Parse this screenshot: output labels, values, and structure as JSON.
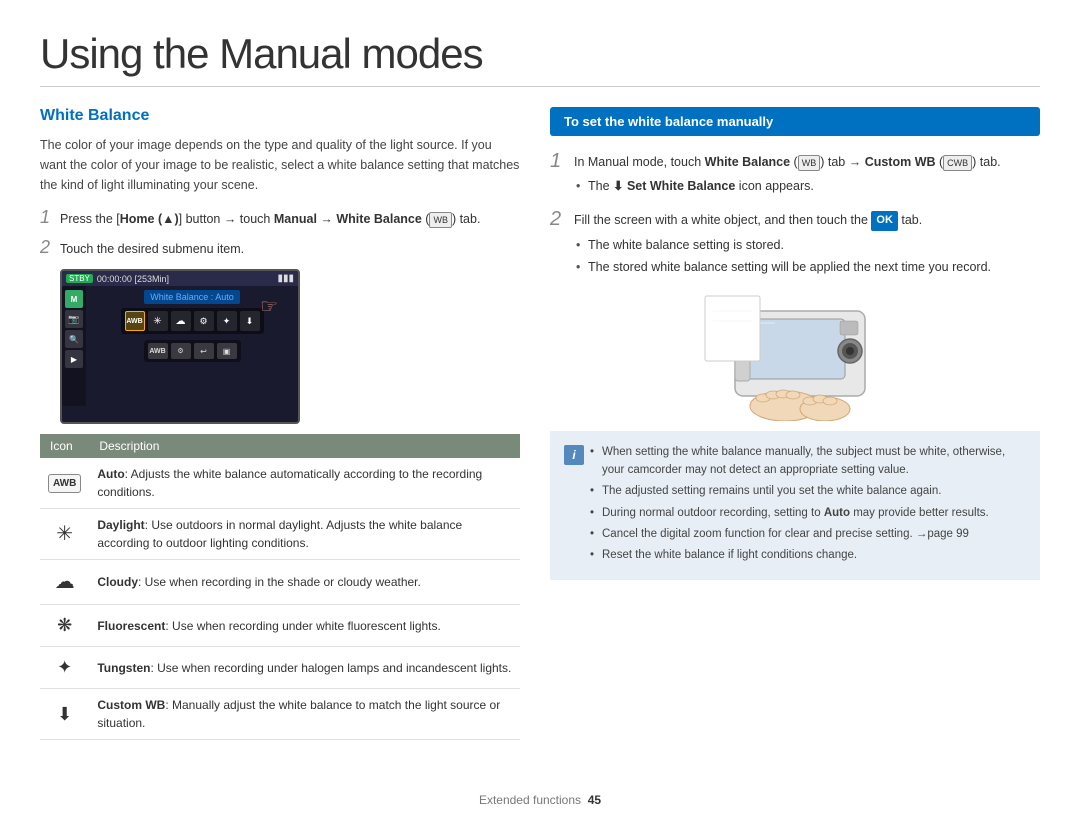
{
  "page": {
    "title": "Using the Manual modes",
    "section_heading": "White Balance",
    "intro_text": "The color of your image depends on the type and quality of the light source. If you want the color of your image to be realistic, select a white balance setting that matches the kind of light illuminating your scene.",
    "footer": {
      "label": "Extended functions",
      "page_num": "45"
    }
  },
  "left_col": {
    "step1_text": "Press the [Home (▲)] button → touch Manual → White Balance (",
    "step1_icon_label": "WB",
    "step1_end": ") tab.",
    "step2_text": "Touch the desired submenu item.",
    "camera_ui": {
      "stby": "STBY",
      "time": "00:00:00 [253Min]",
      "wb_label": "White Balance : Auto",
      "mode": "M"
    },
    "table": {
      "col1": "Icon",
      "col2": "Description",
      "rows": [
        {
          "icon": "AWB",
          "icon_type": "box",
          "title": "Auto",
          "desc": ": Adjusts the white balance automatically according to the recording conditions."
        },
        {
          "icon": "✳",
          "icon_type": "text",
          "title": "Daylight",
          "desc": ": Use outdoors in normal daylight. Adjusts the white balance according to outdoor lighting conditions."
        },
        {
          "icon": "☁",
          "icon_type": "text",
          "title": "Cloudy",
          "desc": ": Use when recording in the shade or cloudy weather."
        },
        {
          "icon": "⚙",
          "icon_type": "text",
          "title": "Fluorescent",
          "desc": ": Use when recording under white fluorescent lights."
        },
        {
          "icon": "✦",
          "icon_type": "text",
          "title": "Tungsten",
          "desc": ": Use when recording under halogen lamps and incandescent lights."
        },
        {
          "icon": "⬇",
          "icon_type": "text",
          "title": "Custom WB",
          "desc": ": Manually adjust the white balance to match the light source or situation."
        }
      ]
    }
  },
  "right_col": {
    "header": "To set the white balance manually",
    "step1": {
      "num": "1",
      "text_before": "In Manual mode, touch ",
      "bold1": "White Balance",
      "icon1": "WB",
      "text_mid": " tab →",
      "bold2": "Custom WB",
      "icon2": "CWB",
      "text_end": " tab.",
      "bullet": "The",
      "bullet_bold": "Set White Balance",
      "bullet_end": "icon appears."
    },
    "step2": {
      "num": "2",
      "text": "Fill the screen with a white object, and then touch the",
      "ok_label": "OK",
      "text_end": "tab.",
      "bullets": [
        "The white balance setting is stored.",
        "The stored white balance setting will be applied the next time you record."
      ]
    },
    "note": {
      "items": [
        "When setting the white balance manually, the subject must be white, otherwise, your camcorder may not detect an appropriate setting value.",
        "The adjusted setting remains until you set the white balance again.",
        "During normal outdoor recording, setting to Auto may provide better results.",
        "Cancel the digital zoom function for clear and precise setting. →page 99",
        "Reset the white balance if light conditions change."
      ],
      "auto_bold": "Auto"
    }
  }
}
